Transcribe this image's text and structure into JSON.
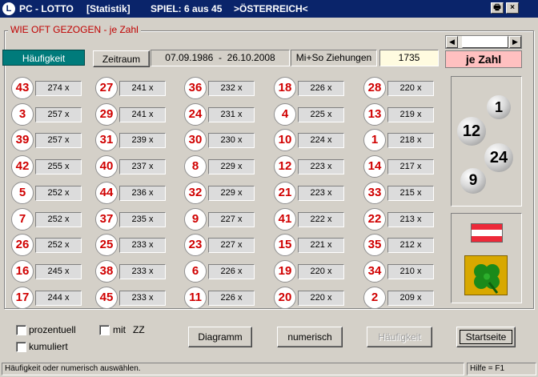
{
  "window": {
    "icon_letter": "L",
    "app_name": "PC - LOTTO",
    "section": "[Statistik]",
    "game": "SPIEL: 6 aus 45",
    "country": ">ÖSTERREICH<",
    "print_glyph": "🖶",
    "close_glyph": "×"
  },
  "group_caption": "WIE OFT GEZOGEN - je Zahl",
  "mode_label": "Häufigkeit",
  "zeitraum_button": "Zeitraum",
  "date_range": "07.09.1986  -  26.10.2008",
  "draw_days": "Mi+So Ziehungen",
  "draw_count": "1735",
  "je_zahl": "je Zahl",
  "scroll": {
    "left": "◀",
    "right": "▶"
  },
  "columns": [
    [
      {
        "n": "43",
        "c": "274 x"
      },
      {
        "n": "3",
        "c": "257 x"
      },
      {
        "n": "39",
        "c": "257 x"
      },
      {
        "n": "42",
        "c": "255 x"
      },
      {
        "n": "5",
        "c": "252 x"
      },
      {
        "n": "7",
        "c": "252 x"
      },
      {
        "n": "26",
        "c": "252 x"
      },
      {
        "n": "16",
        "c": "245 x"
      },
      {
        "n": "17",
        "c": "244 x"
      }
    ],
    [
      {
        "n": "27",
        "c": "241 x"
      },
      {
        "n": "29",
        "c": "241 x"
      },
      {
        "n": "31",
        "c": "239 x"
      },
      {
        "n": "40",
        "c": "237 x"
      },
      {
        "n": "44",
        "c": "236 x"
      },
      {
        "n": "37",
        "c": "235 x"
      },
      {
        "n": "25",
        "c": "233 x"
      },
      {
        "n": "38",
        "c": "233 x"
      },
      {
        "n": "45",
        "c": "233 x"
      }
    ],
    [
      {
        "n": "36",
        "c": "232 x"
      },
      {
        "n": "24",
        "c": "231 x"
      },
      {
        "n": "30",
        "c": "230 x"
      },
      {
        "n": "8",
        "c": "229 x"
      },
      {
        "n": "32",
        "c": "229 x"
      },
      {
        "n": "9",
        "c": "227 x"
      },
      {
        "n": "23",
        "c": "227 x"
      },
      {
        "n": "6",
        "c": "226 x"
      },
      {
        "n": "11",
        "c": "226 x"
      }
    ],
    [
      {
        "n": "18",
        "c": "226 x"
      },
      {
        "n": "4",
        "c": "225 x"
      },
      {
        "n": "10",
        "c": "224 x"
      },
      {
        "n": "12",
        "c": "223 x"
      },
      {
        "n": "21",
        "c": "223 x"
      },
      {
        "n": "41",
        "c": "222 x"
      },
      {
        "n": "15",
        "c": "221 x"
      },
      {
        "n": "19",
        "c": "220 x"
      },
      {
        "n": "20",
        "c": "220 x"
      }
    ],
    [
      {
        "n": "28",
        "c": "220 x"
      },
      {
        "n": "13",
        "c": "219 x"
      },
      {
        "n": "1",
        "c": "218 x"
      },
      {
        "n": "14",
        "c": "217 x"
      },
      {
        "n": "33",
        "c": "215 x"
      },
      {
        "n": "22",
        "c": "213 x"
      },
      {
        "n": "35",
        "c": "212 x"
      },
      {
        "n": "34",
        "c": "210 x"
      },
      {
        "n": "2",
        "c": "209 x"
      }
    ]
  ],
  "lotto_balls": [
    "1",
    "12",
    "24",
    "9"
  ],
  "flag_colors": [
    "#ed2939",
    "#ffffff",
    "#ed2939"
  ],
  "options": {
    "prozentuell": "prozentuell",
    "kumuliert": "kumuliert",
    "mit": "mit",
    "zz": "ZZ"
  },
  "buttons": {
    "diagramm": "Diagramm",
    "numerisch": "numerisch",
    "haeufigkeit": "Häufigkeit",
    "startseite": "Startseite"
  },
  "status": {
    "hint": "Häufigkeit oder numerisch auswählen.",
    "help": "Hilfe = F1"
  }
}
